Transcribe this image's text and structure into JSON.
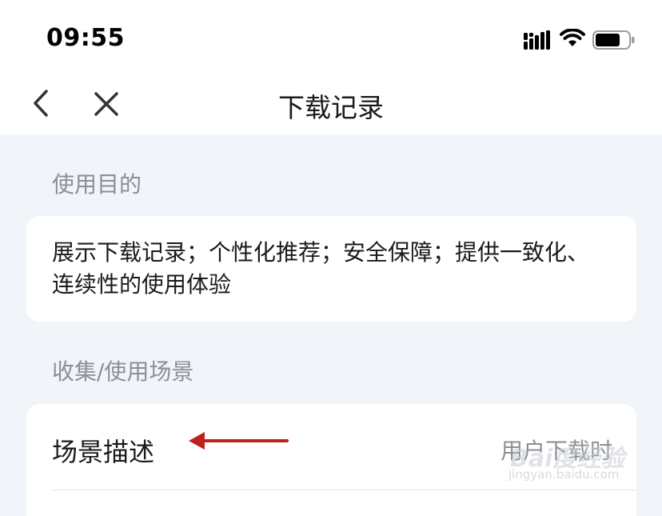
{
  "status_bar": {
    "time": "09:55",
    "icons": [
      "signal-icon",
      "wifi-icon",
      "battery-icon"
    ]
  },
  "nav": {
    "title": "下载记录",
    "back_icon": "chevron-left-icon",
    "close_icon": "close-icon"
  },
  "purpose_section": {
    "label": "使用目的",
    "text": "展示下载记录；个性化推荐；安全保障；提供一致化、连续性的使用体验"
  },
  "scene_section": {
    "label": "收集/使用场景",
    "row_label": "场景描述",
    "row_value": "用户下载时"
  },
  "annotation": {
    "arrow_color": "#c0211c"
  },
  "watermark": {
    "logo": "Bai度经验",
    "url": "jingyan.baidu.com"
  },
  "colors": {
    "background": "#f1f4f8",
    "card": "#ffffff",
    "secondary_text": "#8a8f99",
    "primary_text": "#1a1a1a"
  }
}
